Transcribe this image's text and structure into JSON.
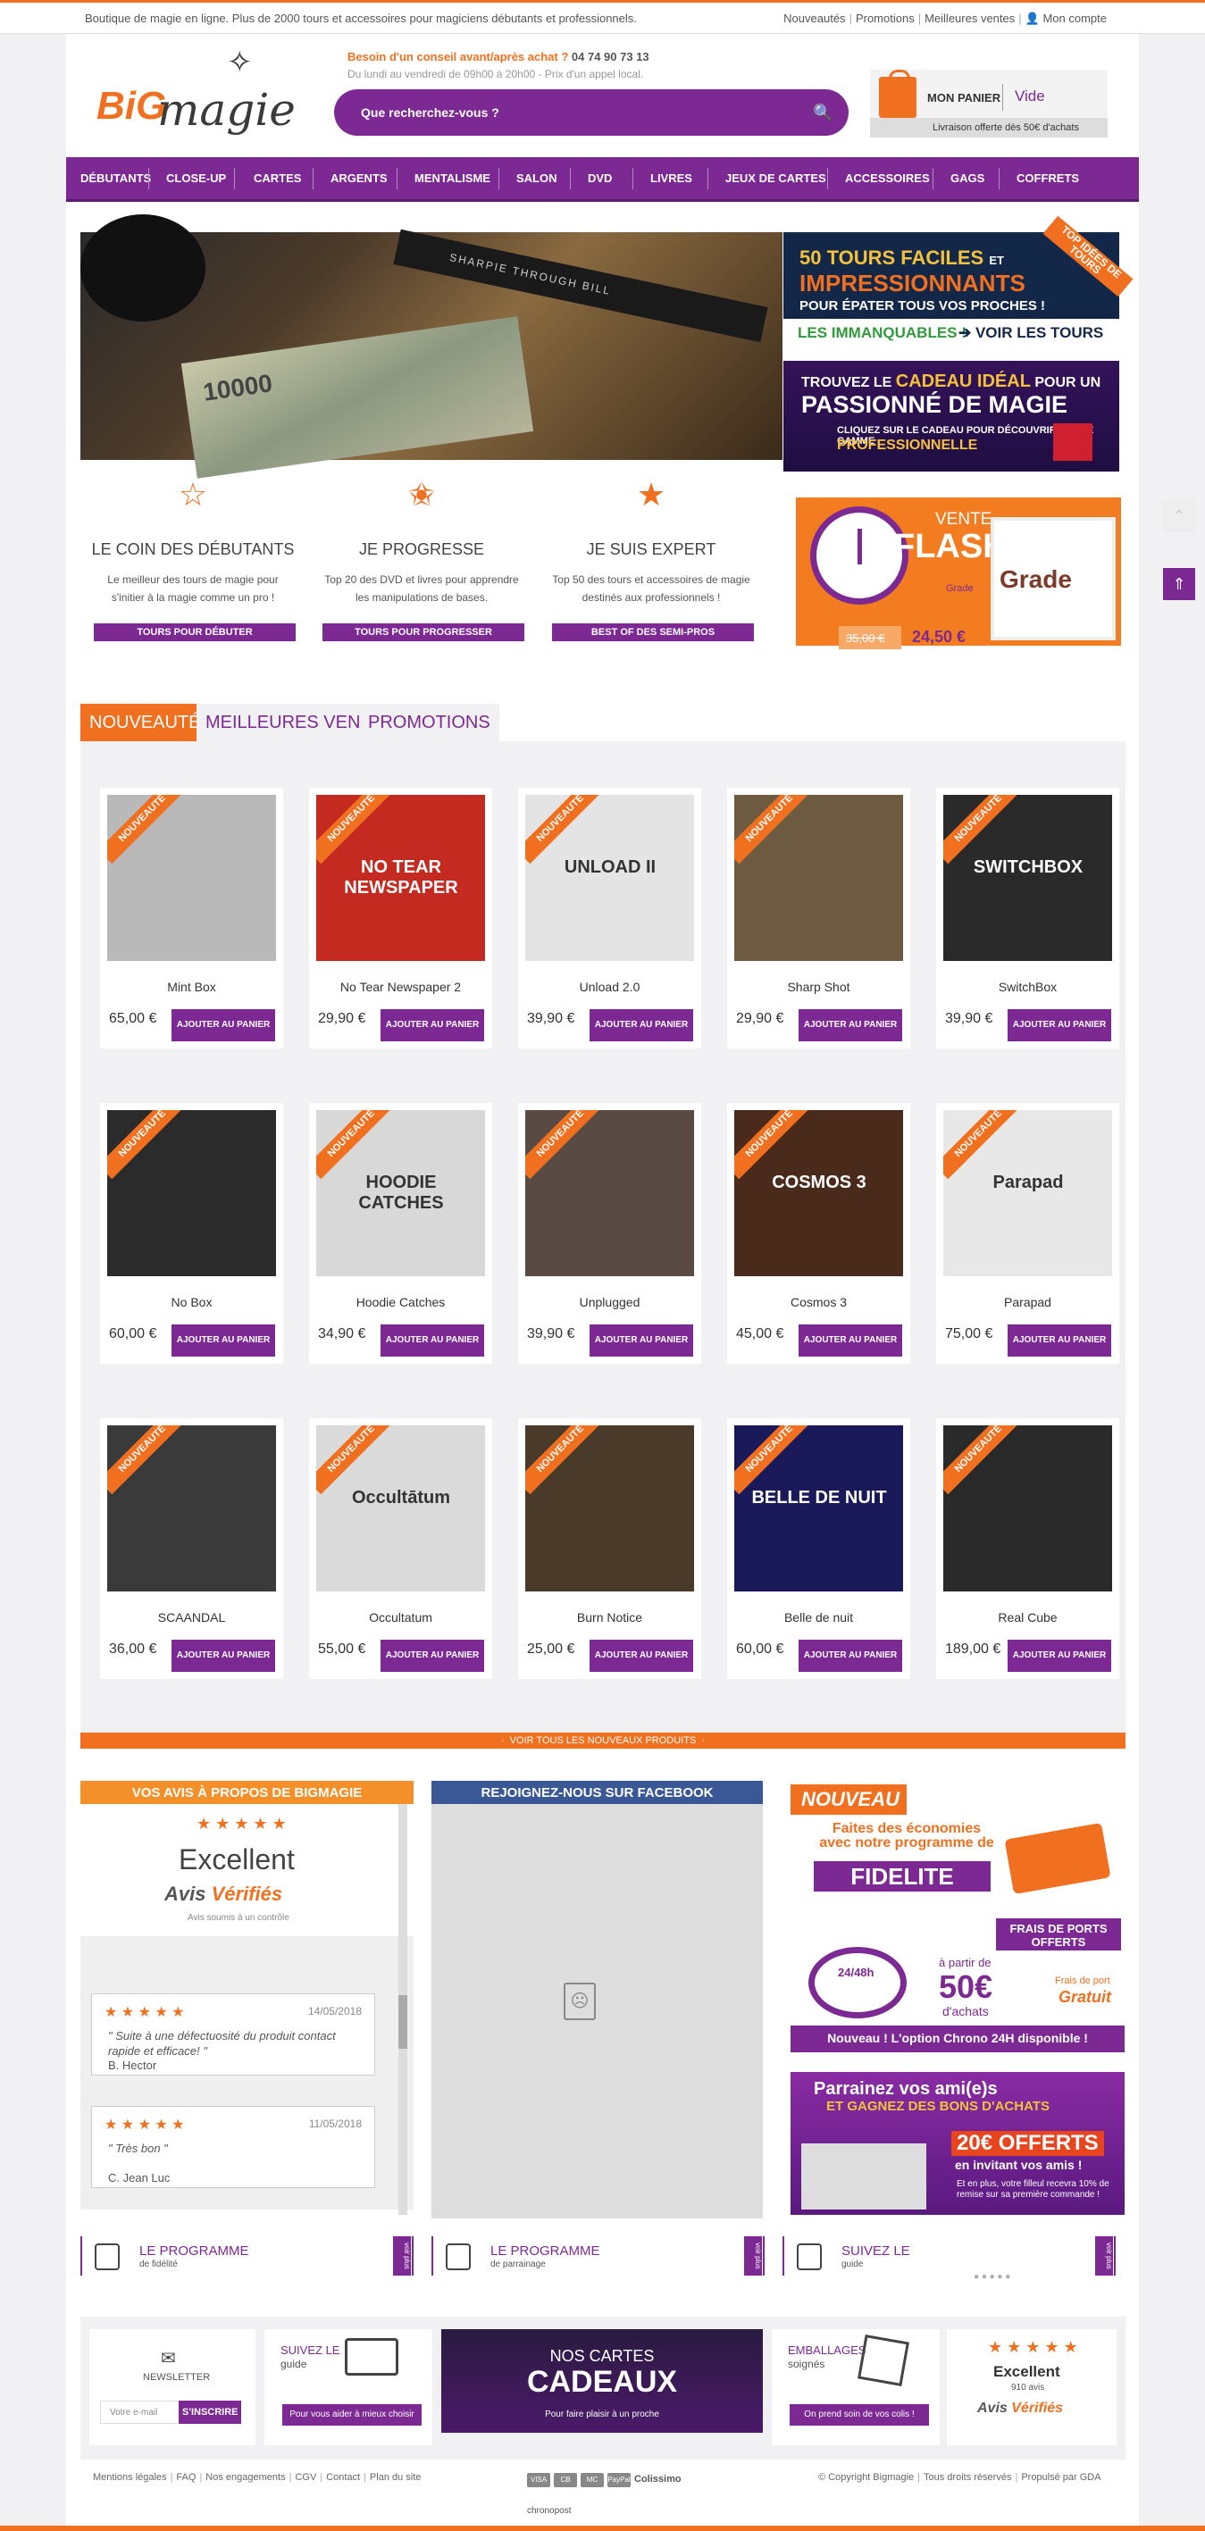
{
  "topbar": {
    "tagline": "Boutique de magie en ligne. Plus de 2000 tours et accessoires pour magiciens débutants et professionnels.",
    "links": [
      "Nouveautés",
      "Promotions",
      "Meilleures ventes"
    ],
    "account": "Mon compte"
  },
  "header": {
    "logo_big": "BiG",
    "logo_magie": "magie",
    "help_label": "Besoin d'un conseil avant/après achat ?",
    "phone": "04 74 90 73 13",
    "hours": "Du lundi au vendredi de 09h00 à 20h00 - Prix d'un appel local.",
    "search_placeholder": "Que recherchez-vous ?",
    "cart_label": "MON PANIER",
    "cart_status": "Vide",
    "shipping_note": "Livraison offerte dès 50€ d'achats"
  },
  "nav": [
    "DÉBUTANTS",
    "CLOSE-UP",
    "CARTES",
    "ARGENTS",
    "MENTALISME",
    "SALON",
    "DVD",
    "LIVRES",
    "JEUX DE CARTES",
    "ACCESSOIRES",
    "GAGS",
    "COFFRETS"
  ],
  "hero": {
    "pen_text": "SHARPIE THROUGH BILL",
    "bill_text": "10000"
  },
  "promo1": {
    "line1": "50 TOURS FACILES",
    "line1_small": "ET",
    "line2": "IMPRESSIONNANTS",
    "line3": "POUR ÉPATER TOUS VOS PROCHES !",
    "foot_left": "LES IMMANQUABLES !",
    "foot_right": "➔ VOIR LES TOURS",
    "ribbon": "TOP IDÉES DE TOURS"
  },
  "promo2": {
    "line1a": "TROUVEZ LE",
    "line1b": "CADEAU IDÉAL",
    "line1c": "POUR UN",
    "line2": "PASSIONNÉ DE MAGIE",
    "line3": "CLIQUEZ SUR LE CADEAU POUR DÉCOUVRIR NOTRE GAMME",
    "line4": "PROFESSIONNELLE"
  },
  "levels": [
    {
      "title": "LE COIN DES DÉBUTANTS",
      "text": "Le meilleur des tours de magie pour s'initier à la magie comme un pro !",
      "button": "TOURS POUR DÉBUTER",
      "star": "☆"
    },
    {
      "title": "JE PROGRESSE",
      "text": "Top 20 des DVD et livres pour apprendre les manipulations de bases.",
      "button": "TOURS POUR PROGRESSER",
      "star": "✬"
    },
    {
      "title": "JE SUIS EXPERT",
      "text": "Top 50 des tours et accessoires de magie destinés aux professionnels !",
      "button": "BEST OF DES SEMI-PROS",
      "star": "★"
    }
  ],
  "flash": {
    "vente": "VENTE",
    "flash": "FLASH",
    "product": "Grade",
    "img_text": "Grade",
    "old_price": "35,00 €",
    "new_price": "24,50 €"
  },
  "tabs": [
    "NOUVEAUTÉS",
    "MEILLEURES VENTES",
    "PROMOTIONS"
  ],
  "badge": "NOUVEAUTÉ",
  "add_label": "AJOUTER AU PANIER",
  "products": [
    {
      "name": "Mint Box",
      "price": "65,00 €",
      "bg": "#b9b9b9"
    },
    {
      "name": "No Tear Newspaper 2",
      "price": "29,90 €",
      "bg": "#c42a1f"
    },
    {
      "name": "Unload 2.0",
      "price": "39,90 €",
      "bg": "#e4e4e4"
    },
    {
      "name": "Sharp Shot",
      "price": "29,90 €",
      "bg": "#6e5c42"
    },
    {
      "name": "SwitchBox",
      "price": "39,90 €",
      "bg": "#2a2a2a"
    },
    {
      "name": "No Box",
      "price": "60,00 €",
      "bg": "#2b2b2b"
    },
    {
      "name": "Hoodie Catches",
      "price": "34,90 €",
      "bg": "#d8d8d8"
    },
    {
      "name": "Unplugged",
      "price": "39,90 €",
      "bg": "#5a4a44"
    },
    {
      "name": "Cosmos 3",
      "price": "45,00 €",
      "bg": "#4a2a1a"
    },
    {
      "name": "Parapad",
      "price": "75,00 €",
      "bg": "#e8e8e8"
    },
    {
      "name": "SCAANDAL",
      "price": "36,00 €",
      "bg": "#3a3a3a"
    },
    {
      "name": "Occultatum",
      "price": "55,00 €",
      "bg": "#dadada"
    },
    {
      "name": "Burn Notice",
      "price": "25,00 €",
      "bg": "#4a3a2a"
    },
    {
      "name": "Belle de nuit",
      "price": "60,00 €",
      "bg": "#1a1a5a"
    },
    {
      "name": "Real Cube",
      "price": "189,00 €",
      "bg": "#2a2a2a"
    }
  ],
  "product_img_text": [
    "",
    "NO TEAR NEWSPAPER",
    "UNLOAD II",
    "",
    "SWITCHBOX",
    "",
    "HOODIE CATCHES",
    "",
    "COSMOS 3",
    "Parapad",
    "",
    "Occultātum",
    "",
    "BELLE DE NUIT",
    ""
  ],
  "all_new": "VOIR TOUS LES NOUVEAUX PRODUITS",
  "reviews": {
    "header": "VOS AVIS À PROPOS DE BIGMAGIE",
    "stars": "★ ★ ★ ★ ★",
    "rating": "Excellent",
    "brand_a": "Avis",
    "brand_b": "Vérifiés",
    "note": "Avis soumis à un contrôle",
    "items": [
      {
        "stars": "★ ★ ★ ★ ★",
        "date": "14/05/2018",
        "quote": "\" Suite à une défectuosité du produit contact rapide et efficace! \"",
        "author": "B. Hector"
      },
      {
        "stars": "★ ★ ★ ★ ★",
        "date": "11/05/2018",
        "quote": "\" Très bon \"",
        "author": "C. Jean Luc"
      }
    ]
  },
  "facebook": {
    "header": "REJOIGNEZ-NOUS SUR FACEBOOK"
  },
  "fidelite": {
    "nouveau": "NOUVEAU",
    "line1": "Faites des économies avec notre programme de",
    "line2": "FIDELITE"
  },
  "shipping": {
    "tag": "FRAIS DE PORTS OFFERTS",
    "delay": "24/48h",
    "from": "à partir de",
    "amount": "50€",
    "purchases": "d'achats",
    "fees": "Frais de port",
    "free": "Gratuit",
    "chrono": "Nouveau ! L'option Chrono 24H disponible !"
  },
  "parrainage": {
    "line1": "Parrainez vos ami(e)s",
    "line2": "ET GAGNEZ DES BONS D'ACHATS",
    "line3": "20€ OFFERTS",
    "line4": "en invitant vos amis !",
    "line5": "Et en plus, votre filleul recevra 10% de remise sur sa première commande !"
  },
  "programs": [
    {
      "title": "LE PROGRAMME",
      "sub": "de fidélité",
      "side": "voir plus"
    },
    {
      "title": "LE PROGRAMME",
      "sub": "de parrainage",
      "side": "voir plus"
    },
    {
      "title": "SUIVEZ LE",
      "sub": "guide",
      "side": "voir plus"
    }
  ],
  "footer": {
    "newsletter": "NEWSLETTER",
    "email_placeholder": "Votre e-mail",
    "subscribe": "S'INSCRIRE",
    "guide_t1": "SUIVEZ LE",
    "guide_t2": "guide",
    "guide_btn": "Pour vous aider à mieux choisir",
    "cards_l1": "NOS CARTES",
    "cards_l2": "CADEAUX",
    "cards_l3": "Pour faire plaisir à un proche",
    "wrap_t1": "EMBALLAGES",
    "wrap_t2": "soignés",
    "wrap_btn": "On prend soin de vos colis !",
    "avis_stars": "★ ★ ★ ★ ★",
    "avis_rating": "Excellent",
    "avis_count": "910 avis",
    "avis_brand_a": "Avis",
    "avis_brand_b": "Vérifiés"
  },
  "bottom": {
    "links": [
      "Mentions légales",
      "FAQ",
      "Nos engagements",
      "CGV",
      "Contact",
      "Plan du site"
    ],
    "payments": [
      "VISA",
      "CB",
      "MC",
      "PayPal"
    ],
    "colissimo": "Colissimo",
    "copy": "© Copyright Bigmagie",
    "rights": "Tous droits réservés",
    "by": "Propulsé par GDA",
    "chrono": "chronopost"
  }
}
